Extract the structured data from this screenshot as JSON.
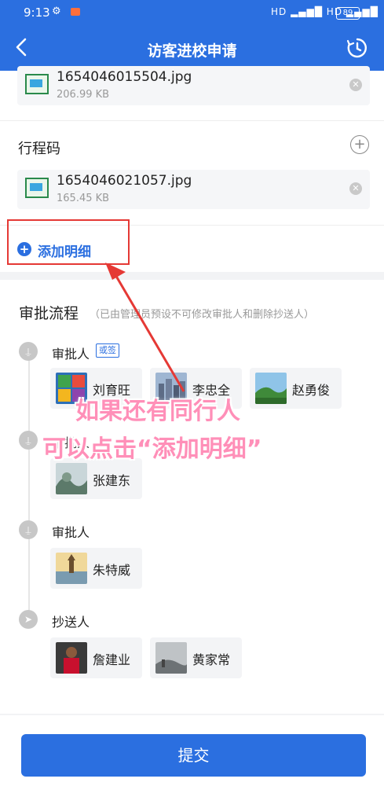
{
  "status_bar": {
    "time": "9:13",
    "signal": "HD ▂▄▆█ HD ▂▄▆█",
    "battery": "89"
  },
  "header": {
    "title": "访客进校申请"
  },
  "attachments_top": {
    "file": {
      "name": "1654046015504.jpg",
      "size": "206.99 KB"
    }
  },
  "trip_code": {
    "label": "行程码",
    "file": {
      "name": "1654046021057.jpg",
      "size": "165.45 KB"
    }
  },
  "add_detail": {
    "label": "添加明细"
  },
  "approval": {
    "title": "审批流程",
    "note": "（已由管理员预设不可修改审批人和删除抄送人）",
    "steps": [
      {
        "label": "审批人",
        "badge": "或签",
        "people": [
          "刘育旺",
          "李忠全",
          "赵勇俊"
        ]
      },
      {
        "label": "审批人",
        "people": [
          "张建东"
        ]
      },
      {
        "label": "审批人",
        "people": [
          "朱特威"
        ]
      },
      {
        "label": "抄送人",
        "people": [
          "詹建业",
          "黄家常"
        ]
      }
    ]
  },
  "caption": {
    "line1": "如果还有同行人",
    "line2": "可以点击“添加明细”"
  },
  "submit": {
    "label": "提交"
  },
  "colors": {
    "primary": "#2b6fe0",
    "annotation_red": "#e53935",
    "caption_pink": "#ff8fb8"
  }
}
